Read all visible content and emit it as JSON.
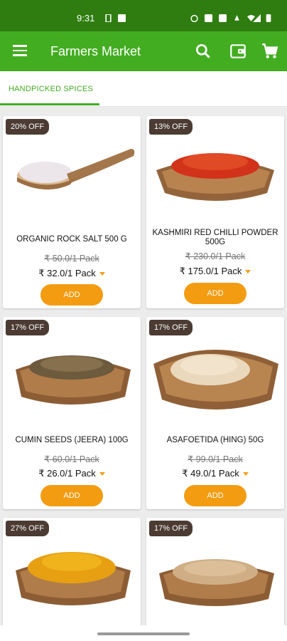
{
  "status_bar": {
    "time": "9:31"
  },
  "app_bar": {
    "title": "Farmers Market",
    "icons": [
      "menu-icon",
      "search-icon",
      "wallet-icon",
      "cart-icon"
    ]
  },
  "tabs": [
    {
      "label": "HANDPICKED SPICES",
      "active": true
    }
  ],
  "colors": {
    "primary": "#43ad21",
    "status_bar": "#2f7d10",
    "accent": "#f39c12",
    "badge": "#4b3b32"
  },
  "products": [
    {
      "discount": "20% OFF",
      "name": "ORGANIC ROCK SALT 500 G",
      "old_price": "₹ 50.0/1 Pack",
      "price": "₹ 32.0/1 Pack",
      "button": "ADD"
    },
    {
      "discount": "13% OFF",
      "name": "KASHMIRI RED CHILLI POWDER 500G",
      "old_price": "₹ 230.0/1 Pack",
      "price": "₹ 175.0/1 Pack",
      "button": "ADD"
    },
    {
      "discount": "17% OFF",
      "name": "CUMIN SEEDS (JEERA) 100G",
      "old_price": "₹ 60.0/1 Pack",
      "price": "₹ 26.0/1 Pack",
      "button": "ADD"
    },
    {
      "discount": "17% OFF",
      "name": "ASAFOETIDA (HING) 50G",
      "old_price": "₹ 99.0/1 Pack",
      "price": "₹ 49.0/1 Pack",
      "button": "ADD"
    },
    {
      "discount": "27% OFF"
    },
    {
      "discount": "17% OFF"
    }
  ]
}
